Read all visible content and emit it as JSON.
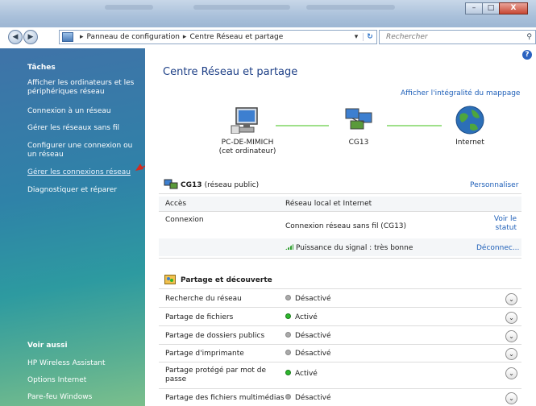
{
  "window": {
    "controls": [
      "–",
      "□",
      "X"
    ]
  },
  "address_bar": {
    "crumbs": [
      "Panneau de configuration",
      "Centre Réseau et partage"
    ],
    "search_placeholder": "Rechercher"
  },
  "sidebar": {
    "tasks_title": "Tâches",
    "tasks": [
      "Afficher les ordinateurs et les périphériques réseau",
      "Connexion à un réseau",
      "Gérer les réseaux sans fil",
      "Configurer une connexion ou un réseau",
      "Gérer les connexions réseau",
      "Diagnostiquer et réparer"
    ],
    "see_also_title": "Voir aussi",
    "see_also": [
      "HP Wireless Assistant",
      "Options Internet",
      "Pare-feu Windows"
    ]
  },
  "main": {
    "title": "Centre Réseau et partage",
    "view_full_map": "Afficher l'intégralité du mappage",
    "map": {
      "computer_name": "PC-DE-MIMICH",
      "computer_sub": "(cet ordinateur)",
      "network_name": "CG13",
      "internet": "Internet"
    },
    "network": {
      "name": "CG13",
      "type": "(réseau public)",
      "customize": "Personnaliser",
      "access_label": "Accès",
      "access_value": "Réseau local et Internet",
      "connection_label": "Connexion",
      "connection_value": "Connexion réseau sans fil (CG13)",
      "view_status": "Voir le statut",
      "signal": "Puissance du signal : très bonne",
      "disconnect": "Déconnec..."
    },
    "sharing": {
      "title": "Partage et découverte",
      "rows": [
        {
          "label": "Recherche du réseau",
          "status": "Désactivé",
          "on": false
        },
        {
          "label": "Partage de fichiers",
          "status": "Activé",
          "on": true
        },
        {
          "label": "Partage de dossiers publics",
          "status": "Désactivé",
          "on": false
        },
        {
          "label": "Partage d'imprimante",
          "status": "Désactivé",
          "on": false
        },
        {
          "label": "Partage protégé par mot de passe",
          "status": "Activé",
          "on": true
        },
        {
          "label": "Partage des fichiers multimédias",
          "status": "Désactivé",
          "on": false
        }
      ]
    }
  }
}
